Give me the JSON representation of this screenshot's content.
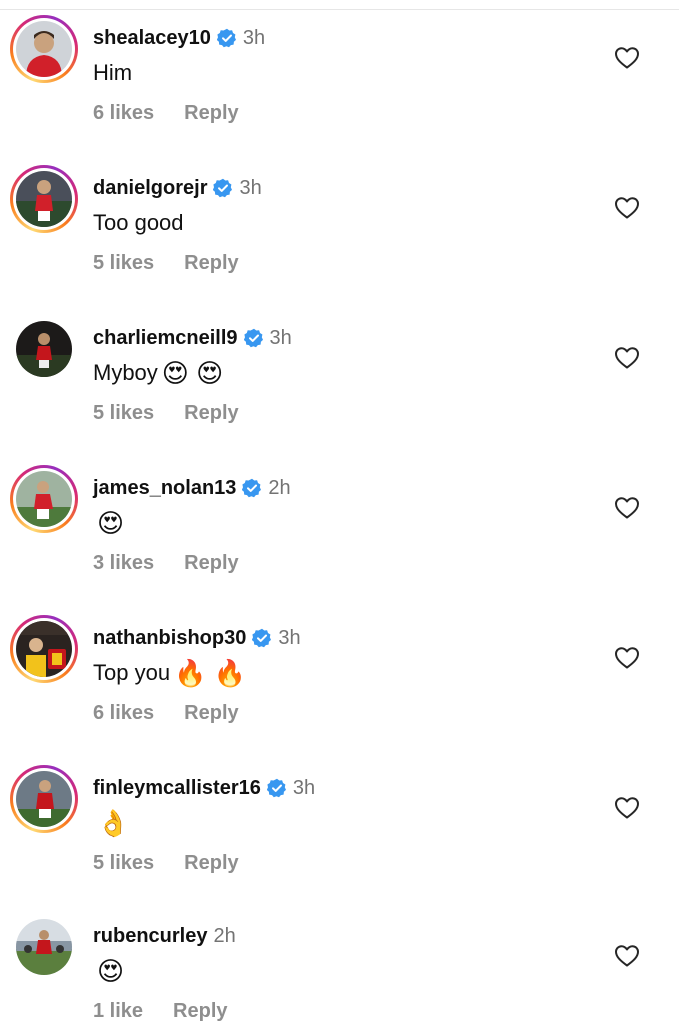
{
  "colors": {
    "verified": "#3897f0",
    "meta_text": "#8e8e8e",
    "time_text": "#737373",
    "heart_stroke": "#262626"
  },
  "comments": [
    {
      "username": "shealacey10",
      "verified": true,
      "time": "3h",
      "text": "Him",
      "emoji": "",
      "likes": "6 likes",
      "reply": "Reply",
      "story_ring": true
    },
    {
      "username": "danielgorejr",
      "verified": true,
      "time": "3h",
      "text": "Too good",
      "emoji": "",
      "likes": "5 likes",
      "reply": "Reply",
      "story_ring": true
    },
    {
      "username": "charliemcneill9",
      "verified": true,
      "time": "3h",
      "text": "Myboy",
      "emoji": "😍 😍",
      "likes": "5 likes",
      "reply": "Reply",
      "story_ring": false
    },
    {
      "username": "james_nolan13",
      "verified": true,
      "time": "2h",
      "text": "",
      "emoji": "😍",
      "likes": "3 likes",
      "reply": "Reply",
      "story_ring": true
    },
    {
      "username": "nathanbishop30",
      "verified": true,
      "time": "3h",
      "text": "Top you",
      "emoji": "🔥 🔥",
      "likes": "6 likes",
      "reply": "Reply",
      "story_ring": true
    },
    {
      "username": "finleymcallister16",
      "verified": true,
      "time": "3h",
      "text": "",
      "emoji": "👌",
      "likes": "5 likes",
      "reply": "Reply",
      "story_ring": true
    },
    {
      "username": "rubencurley",
      "verified": false,
      "time": "2h",
      "text": "",
      "emoji": "😍",
      "likes": "1 like",
      "reply": "Reply",
      "story_ring": false
    }
  ]
}
